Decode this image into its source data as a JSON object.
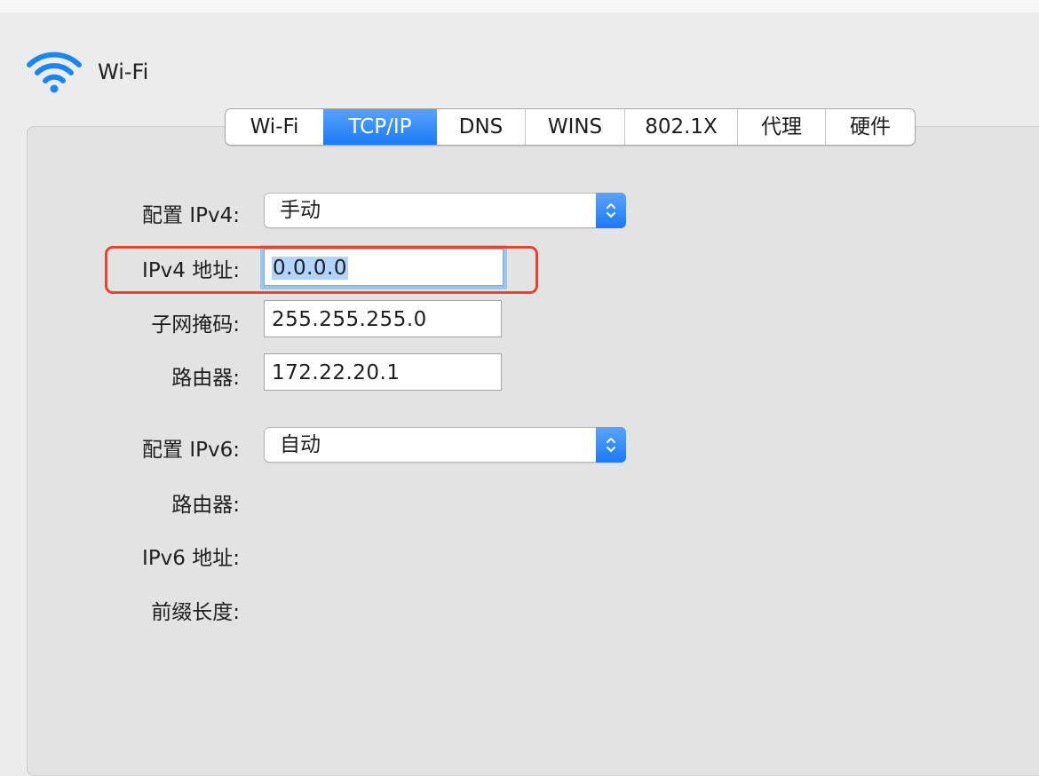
{
  "header": {
    "title": "Wi-Fi",
    "icon": "wifi-icon",
    "icon_color": "#1b86f1"
  },
  "tabs": [
    {
      "label": "Wi-Fi",
      "active": false
    },
    {
      "label": "TCP/IP",
      "active": true
    },
    {
      "label": "DNS",
      "active": false
    },
    {
      "label": "WINS",
      "active": false
    },
    {
      "label": "802.1X",
      "active": false
    },
    {
      "label": "代理",
      "active": false
    },
    {
      "label": "硬件",
      "active": false
    }
  ],
  "ipv4": {
    "config_label": "配置 IPv4:",
    "config_value": "手动",
    "address_label": "IPv4 地址:",
    "address_value": "0.0.0.0",
    "subnet_label": "子网掩码:",
    "subnet_value": "255.255.255.0",
    "router_label": "路由器:",
    "router_value": "172.22.20.1"
  },
  "ipv6": {
    "config_label": "配置 IPv6:",
    "config_value": "自动",
    "router_label": "路由器:",
    "address_label": "IPv6 地址:",
    "prefix_label": "前缀长度:"
  },
  "colors": {
    "accent": "#1b7bf6",
    "annotation": "#e8432e",
    "background": "#ececec"
  }
}
